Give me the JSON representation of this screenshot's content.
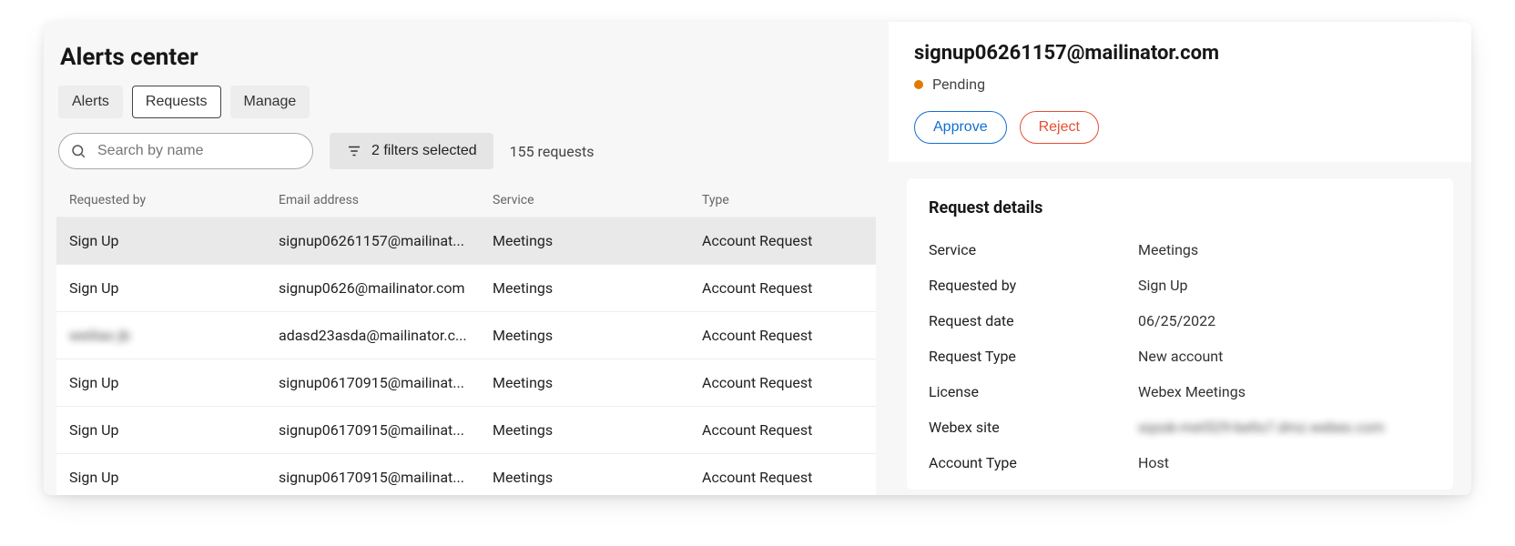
{
  "page_title": "Alerts center",
  "tabs": [
    {
      "label": "Alerts",
      "active": false
    },
    {
      "label": "Requests",
      "active": true
    },
    {
      "label": "Manage",
      "active": false
    }
  ],
  "search": {
    "placeholder": "Search by name",
    "value": ""
  },
  "filters": {
    "label": "2 filters selected"
  },
  "count_label": "155 requests",
  "table": {
    "columns": [
      "Requested by",
      "Email address",
      "Service",
      "Type"
    ],
    "rows": [
      {
        "requested_by": "Sign Up",
        "email": "signup06261157@mailinat...",
        "service": "Meetings",
        "type": "Account Request",
        "selected": true,
        "blurred": false
      },
      {
        "requested_by": "Sign Up",
        "email": "signup0626@mailinator.com",
        "service": "Meetings",
        "type": "Account Request",
        "selected": false,
        "blurred": false
      },
      {
        "requested_by": "weiliao jb",
        "email": "adasd23asda@mailinator.c...",
        "service": "Meetings",
        "type": "Account Request",
        "selected": false,
        "blurred": true
      },
      {
        "requested_by": "Sign Up",
        "email": "signup06170915@mailinat...",
        "service": "Meetings",
        "type": "Account Request",
        "selected": false,
        "blurred": false
      },
      {
        "requested_by": "Sign Up",
        "email": "signup06170915@mailinat...",
        "service": "Meetings",
        "type": "Account Request",
        "selected": false,
        "blurred": false
      },
      {
        "requested_by": "Sign Up",
        "email": "signup06170915@mailinat...",
        "service": "Meetings",
        "type": "Account Request",
        "selected": false,
        "blurred": false
      }
    ]
  },
  "detail": {
    "title": "signup06261157@mailinator.com",
    "status_label": "Pending",
    "status_color": "#e07a00",
    "approve_label": "Approve",
    "reject_label": "Reject",
    "section_title": "Request details",
    "rows": [
      {
        "k": "Service",
        "v": "Meetings",
        "blurred": false
      },
      {
        "k": "Requested by",
        "v": "Sign Up",
        "blurred": false
      },
      {
        "k": "Request date",
        "v": "06/25/2022",
        "blurred": false
      },
      {
        "k": "Request Type",
        "v": "New account",
        "blurred": false
      },
      {
        "k": "License",
        "v": "Webex Meetings",
        "blurred": false
      },
      {
        "k": "Webex site",
        "v": "sqssk-met529-belts7.dmz.webex.com",
        "blurred": true
      },
      {
        "k": "Account Type",
        "v": "Host",
        "blurred": false
      }
    ]
  }
}
